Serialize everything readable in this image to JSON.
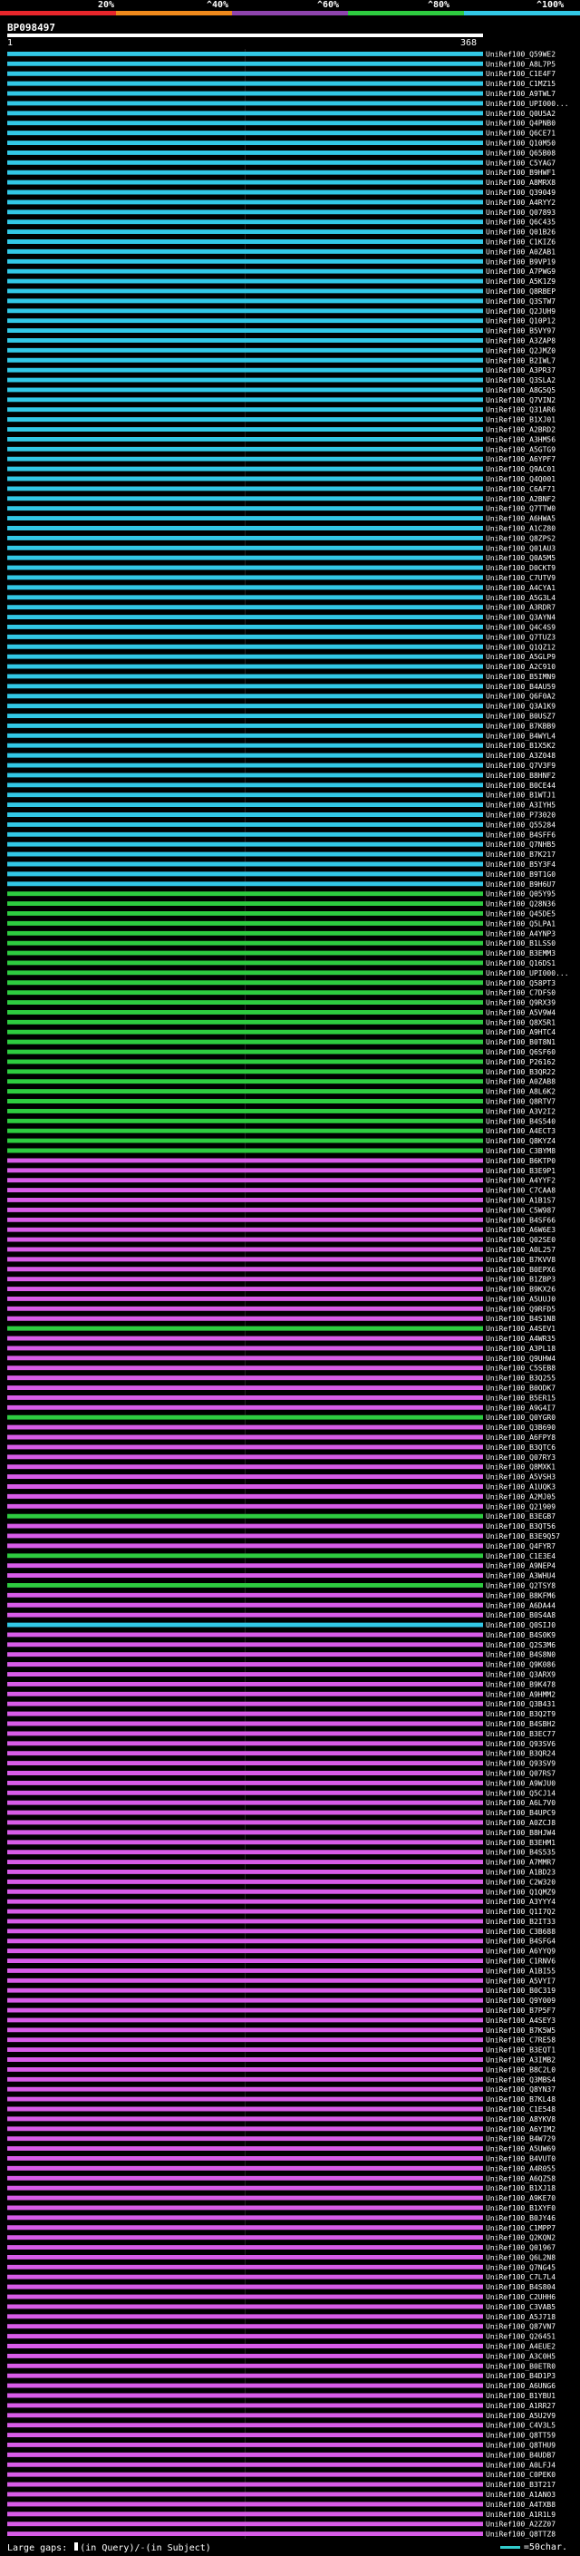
{
  "legend": {
    "labels": [
      "20%",
      "^40%",
      "^60%",
      "^80%",
      "^100%"
    ],
    "colors": [
      "#e8262b",
      "#f08a1c",
      "#8e44ad",
      "#2ecc40",
      "#32c8e6"
    ]
  },
  "query_id": "BP098497",
  "axis": {
    "start": "1",
    "end": "368"
  },
  "footer": {
    "prefix": "Large gaps:",
    "in_query": "(in Query)",
    "sep": "/",
    "in_subject": "(in Subject)"
  },
  "scale_key": "=50char.",
  "chart_data": {
    "type": "alignment",
    "query_length": 368,
    "hits": [
      {
        "id": "UniRef100_Q59WE2",
        "c": "cyan"
      },
      {
        "id": "UniRef100_A8L7P5",
        "c": "cyan"
      },
      {
        "id": "UniRef100_C1E4F7",
        "c": "cyan"
      },
      {
        "id": "UniRef100_C1MZ15",
        "c": "cyan"
      },
      {
        "id": "UniRef100_A9TWL7",
        "c": "cyan"
      },
      {
        "id": "UniRef100_UPI000...",
        "c": "cyan"
      },
      {
        "id": "UniRef100_Q0U5A2",
        "c": "cyan"
      },
      {
        "id": "UniRef100_Q4PNB0",
        "c": "cyan"
      },
      {
        "id": "UniRef100_Q6CE71",
        "c": "cyan"
      },
      {
        "id": "UniRef100_Q10M50",
        "c": "cyan"
      },
      {
        "id": "UniRef100_Q65B08",
        "c": "cyan"
      },
      {
        "id": "UniRef100_C5YAG7",
        "c": "cyan"
      },
      {
        "id": "UniRef100_B9HWF1",
        "c": "cyan"
      },
      {
        "id": "UniRef100_A8MRX8",
        "c": "cyan"
      },
      {
        "id": "UniRef100_Q39049",
        "c": "cyan"
      },
      {
        "id": "UniRef100_A4RYY2",
        "c": "cyan"
      },
      {
        "id": "UniRef100_Q07893",
        "c": "cyan"
      },
      {
        "id": "UniRef100_Q6C435",
        "c": "cyan"
      },
      {
        "id": "UniRef100_Q01B26",
        "c": "cyan"
      },
      {
        "id": "UniRef100_C1KIZ6",
        "c": "cyan"
      },
      {
        "id": "UniRef100_A0ZAB1",
        "c": "cyan"
      },
      {
        "id": "UniRef100_B9VP19",
        "c": "cyan"
      },
      {
        "id": "UniRef100_A7PWG9",
        "c": "cyan"
      },
      {
        "id": "UniRef100_A5K1Z9",
        "c": "cyan"
      },
      {
        "id": "UniRef100_Q8RBEP",
        "c": "cyan"
      },
      {
        "id": "UniRef100_Q3STW7",
        "c": "cyan"
      },
      {
        "id": "UniRef100_Q2JUH9",
        "c": "cyan"
      },
      {
        "id": "UniRef100_Q10P12",
        "c": "cyan"
      },
      {
        "id": "UniRef100_B5VY97",
        "c": "cyan"
      },
      {
        "id": "UniRef100_A3ZAP8",
        "c": "cyan"
      },
      {
        "id": "UniRef100_Q2JMZ0",
        "c": "cyan"
      },
      {
        "id": "UniRef100_B2IWL7",
        "c": "cyan"
      },
      {
        "id": "UniRef100_A3PR37",
        "c": "cyan"
      },
      {
        "id": "UniRef100_Q3SLA2",
        "c": "cyan"
      },
      {
        "id": "UniRef100_A8G5Q5",
        "c": "cyan"
      },
      {
        "id": "UniRef100_Q7VIN2",
        "c": "cyan"
      },
      {
        "id": "UniRef100_Q31AR6",
        "c": "cyan"
      },
      {
        "id": "UniRef100_B1XJ01",
        "c": "cyan"
      },
      {
        "id": "UniRef100_A2BRD2",
        "c": "cyan"
      },
      {
        "id": "UniRef100_A3HM56",
        "c": "cyan"
      },
      {
        "id": "UniRef100_A5GTG9",
        "c": "cyan"
      },
      {
        "id": "UniRef100_A6YPF7",
        "c": "cyan"
      },
      {
        "id": "UniRef100_Q9AC01",
        "c": "cyan"
      },
      {
        "id": "UniRef100_Q4Q001",
        "c": "cyan"
      },
      {
        "id": "UniRef100_C6AF71",
        "c": "cyan"
      },
      {
        "id": "UniRef100_A2BNF2",
        "c": "cyan"
      },
      {
        "id": "UniRef100_Q7TTW0",
        "c": "cyan"
      },
      {
        "id": "UniRef100_A6HWA5",
        "c": "cyan"
      },
      {
        "id": "UniRef100_A1CZ80",
        "c": "cyan"
      },
      {
        "id": "UniRef100_Q8ZPS2",
        "c": "cyan"
      },
      {
        "id": "UniRef100_Q01AU3",
        "c": "cyan"
      },
      {
        "id": "UniRef100_Q0A5M5",
        "c": "cyan"
      },
      {
        "id": "UniRef100_D0CKT9",
        "c": "cyan"
      },
      {
        "id": "UniRef100_C7UTV9",
        "c": "cyan"
      },
      {
        "id": "UniRef100_A4CYA1",
        "c": "cyan"
      },
      {
        "id": "UniRef100_A5G3L4",
        "c": "cyan"
      },
      {
        "id": "UniRef100_A3RDR7",
        "c": "cyan"
      },
      {
        "id": "UniRef100_Q3AYN4",
        "c": "cyan"
      },
      {
        "id": "UniRef100_Q4C4S9",
        "c": "cyan"
      },
      {
        "id": "UniRef100_Q7TUZ3",
        "c": "cyan"
      },
      {
        "id": "UniRef100_Q1QZ12",
        "c": "cyan"
      },
      {
        "id": "UniRef100_A5GLP9",
        "c": "cyan"
      },
      {
        "id": "UniRef100_A2C910",
        "c": "cyan"
      },
      {
        "id": "UniRef100_B5IMN9",
        "c": "cyan"
      },
      {
        "id": "UniRef100_B4AU59",
        "c": "cyan"
      },
      {
        "id": "UniRef100_Q6F0A2",
        "c": "cyan"
      },
      {
        "id": "UniRef100_Q3A1K9",
        "c": "cyan"
      },
      {
        "id": "UniRef100_B0USZ7",
        "c": "cyan"
      },
      {
        "id": "UniRef100_B7KBB9",
        "c": "cyan"
      },
      {
        "id": "UniRef100_B4WYL4",
        "c": "cyan"
      },
      {
        "id": "UniRef100_B1X5K2",
        "c": "cyan"
      },
      {
        "id": "UniRef100_A3Z048",
        "c": "cyan"
      },
      {
        "id": "UniRef100_Q7V3F9",
        "c": "cyan"
      },
      {
        "id": "UniRef100_B8HNF2",
        "c": "cyan"
      },
      {
        "id": "UniRef100_B0CE44",
        "c": "cyan"
      },
      {
        "id": "UniRef100_B1WTJ1",
        "c": "cyan"
      },
      {
        "id": "UniRef100_A3IYH5",
        "c": "cyan"
      },
      {
        "id": "UniRef100_P73020",
        "c": "cyan"
      },
      {
        "id": "UniRef100_Q55284",
        "c": "cyan"
      },
      {
        "id": "UniRef100_B4SFF6",
        "c": "cyan"
      },
      {
        "id": "UniRef100_Q7NHB5",
        "c": "cyan"
      },
      {
        "id": "UniRef100_B7K217",
        "c": "cyan"
      },
      {
        "id": "UniRef100_B5Y3F4",
        "c": "cyan"
      },
      {
        "id": "UniRef100_B9T1G0",
        "c": "cyan"
      },
      {
        "id": "UniRef100_B9H6U7",
        "c": "cyan"
      },
      {
        "id": "UniRef100_Q05Y95",
        "c": "green"
      },
      {
        "id": "UniRef100_Q28N36",
        "c": "green"
      },
      {
        "id": "UniRef100_Q45DE5",
        "c": "green"
      },
      {
        "id": "UniRef100_Q5LPA1",
        "c": "green"
      },
      {
        "id": "UniRef100_A4YNP3",
        "c": "green"
      },
      {
        "id": "UniRef100_B1LSS0",
        "c": "green"
      },
      {
        "id": "UniRef100_B3EMM3",
        "c": "green"
      },
      {
        "id": "UniRef100_Q16DS1",
        "c": "green"
      },
      {
        "id": "UniRef100_UPI000...",
        "c": "green"
      },
      {
        "id": "UniRef100_Q58PT3",
        "c": "green"
      },
      {
        "id": "UniRef100_C7DFS0",
        "c": "green"
      },
      {
        "id": "UniRef100_Q9RX39",
        "c": "green"
      },
      {
        "id": "UniRef100_A5V9W4",
        "c": "green"
      },
      {
        "id": "UniRef100_Q8X5R1",
        "c": "green"
      },
      {
        "id": "UniRef100_A9HTC4",
        "c": "green"
      },
      {
        "id": "UniRef100_B0T8N1",
        "c": "green"
      },
      {
        "id": "UniRef100_Q6SF60",
        "c": "green"
      },
      {
        "id": "UniRef100_P26162",
        "c": "green"
      },
      {
        "id": "UniRef100_B3QR22",
        "c": "green"
      },
      {
        "id": "UniRef100_A0ZAB8",
        "c": "green"
      },
      {
        "id": "UniRef100_A8L6K2",
        "c": "green"
      },
      {
        "id": "UniRef100_Q8RTV7",
        "c": "green"
      },
      {
        "id": "UniRef100_A3V2I2",
        "c": "green"
      },
      {
        "id": "UniRef100_B4S540",
        "c": "green"
      },
      {
        "id": "UniRef100_A4ECT3",
        "c": "green"
      },
      {
        "id": "UniRef100_Q8KYZ4",
        "c": "green"
      },
      {
        "id": "UniRef100_C3BYM8",
        "c": "green"
      },
      {
        "id": "UniRef100_B6KTP0",
        "c": "magenta"
      },
      {
        "id": "UniRef100_B3E9P1",
        "c": "magenta"
      },
      {
        "id": "UniRef100_A4YYF2",
        "c": "magenta"
      },
      {
        "id": "UniRef100_C7CAA8",
        "c": "magenta"
      },
      {
        "id": "UniRef100_A1B1S7",
        "c": "magenta"
      },
      {
        "id": "UniRef100_C5W987",
        "c": "magenta"
      },
      {
        "id": "UniRef100_B4SF66",
        "c": "magenta"
      },
      {
        "id": "UniRef100_A6W6E3",
        "c": "magenta"
      },
      {
        "id": "UniRef100_Q02SE0",
        "c": "magenta"
      },
      {
        "id": "UniRef100_A0L257",
        "c": "magenta"
      },
      {
        "id": "UniRef100_B7KVV8",
        "c": "magenta"
      },
      {
        "id": "UniRef100_B0EPX6",
        "c": "magenta"
      },
      {
        "id": "UniRef100_B1ZBP3",
        "c": "magenta"
      },
      {
        "id": "UniRef100_B9KX26",
        "c": "magenta"
      },
      {
        "id": "UniRef100_A5UUJ0",
        "c": "magenta"
      },
      {
        "id": "UniRef100_Q9RFD5",
        "c": "magenta"
      },
      {
        "id": "UniRef100_B4S1N8",
        "c": "magenta"
      },
      {
        "id": "UniRef100_A4SEV1",
        "c": "green"
      },
      {
        "id": "UniRef100_A4WR35",
        "c": "magenta"
      },
      {
        "id": "UniRef100_A3PL18",
        "c": "magenta"
      },
      {
        "id": "UniRef100_Q9UHW4",
        "c": "magenta"
      },
      {
        "id": "UniRef100_C5SEB8",
        "c": "magenta"
      },
      {
        "id": "UniRef100_B3Q255",
        "c": "magenta"
      },
      {
        "id": "UniRef100_B0ODK7",
        "c": "magenta"
      },
      {
        "id": "UniRef100_B5ER15",
        "c": "magenta"
      },
      {
        "id": "UniRef100_A9G4I7",
        "c": "magenta"
      },
      {
        "id": "UniRef100_Q0YGR0",
        "c": "green"
      },
      {
        "id": "UniRef100_Q3B690",
        "c": "magenta"
      },
      {
        "id": "UniRef100_A6FPY8",
        "c": "magenta"
      },
      {
        "id": "UniRef100_B3QTC6",
        "c": "magenta"
      },
      {
        "id": "UniRef100_Q07RY3",
        "c": "magenta"
      },
      {
        "id": "UniRef100_Q8MXK1",
        "c": "magenta"
      },
      {
        "id": "UniRef100_A5VSH3",
        "c": "magenta"
      },
      {
        "id": "UniRef100_A1UQK3",
        "c": "magenta"
      },
      {
        "id": "UniRef100_A2MJ05",
        "c": "magenta"
      },
      {
        "id": "UniRef100_Q21909",
        "c": "magenta"
      },
      {
        "id": "UniRef100_B3EGB7",
        "c": "green"
      },
      {
        "id": "UniRef100_B3QT56",
        "c": "magenta"
      },
      {
        "id": "UniRef100_B3E9Q57",
        "c": "magenta"
      },
      {
        "id": "UniRef100_Q4FYR7",
        "c": "magenta"
      },
      {
        "id": "UniRef100_C1E3E4",
        "c": "green"
      },
      {
        "id": "UniRef100_A9NEP4",
        "c": "magenta"
      },
      {
        "id": "UniRef100_A3WHU4",
        "c": "magenta"
      },
      {
        "id": "UniRef100_Q2TSY8",
        "c": "green"
      },
      {
        "id": "UniRef100_B8KFM6",
        "c": "magenta"
      },
      {
        "id": "UniRef100_A6DA44",
        "c": "magenta"
      },
      {
        "id": "UniRef100_B0S4A8",
        "c": "magenta"
      },
      {
        "id": "UniRef100_Q0SIJ0",
        "c": "cyan"
      },
      {
        "id": "UniRef100_B4S0K9",
        "c": "magenta"
      },
      {
        "id": "UniRef100_Q2S3M6",
        "c": "magenta"
      },
      {
        "id": "UniRef100_B4S8N0",
        "c": "magenta"
      },
      {
        "id": "UniRef100_Q9K086",
        "c": "magenta"
      },
      {
        "id": "UniRef100_Q3ARX9",
        "c": "magenta"
      },
      {
        "id": "UniRef100_B9K478",
        "c": "magenta"
      },
      {
        "id": "UniRef100_A9HMM2",
        "c": "magenta"
      },
      {
        "id": "UniRef100_Q3B431",
        "c": "magenta"
      },
      {
        "id": "UniRef100_B3Q2T9",
        "c": "magenta"
      },
      {
        "id": "UniRef100_B4SBH2",
        "c": "magenta"
      },
      {
        "id": "UniRef100_B3EC77",
        "c": "magenta"
      },
      {
        "id": "UniRef100_Q93SV6",
        "c": "magenta"
      },
      {
        "id": "UniRef100_B3QR24",
        "c": "magenta"
      },
      {
        "id": "UniRef100_Q93SV9",
        "c": "magenta"
      },
      {
        "id": "UniRef100_Q07RS7",
        "c": "magenta"
      },
      {
        "id": "UniRef100_A9WJU0",
        "c": "magenta"
      },
      {
        "id": "UniRef100_Q5CJ14",
        "c": "magenta"
      },
      {
        "id": "UniRef100_A6L7V0",
        "c": "magenta"
      },
      {
        "id": "UniRef100_B4UPC9",
        "c": "magenta"
      },
      {
        "id": "UniRef100_A0ZCJ8",
        "c": "magenta"
      },
      {
        "id": "UniRef100_B8HJW4",
        "c": "magenta"
      },
      {
        "id": "UniRef100_B3EHM1",
        "c": "magenta"
      },
      {
        "id": "UniRef100_B4S535",
        "c": "magenta"
      },
      {
        "id": "UniRef100_A7MMR7",
        "c": "magenta"
      },
      {
        "id": "UniRef100_A1BD23",
        "c": "magenta"
      },
      {
        "id": "UniRef100_C2W320",
        "c": "magenta"
      },
      {
        "id": "UniRef100_Q1QMZ9",
        "c": "magenta"
      },
      {
        "id": "UniRef100_A3YYY4",
        "c": "magenta"
      },
      {
        "id": "UniRef100_Q1I7Q2",
        "c": "magenta"
      },
      {
        "id": "UniRef100_B2IT33",
        "c": "magenta"
      },
      {
        "id": "UniRef100_C3B688",
        "c": "magenta"
      },
      {
        "id": "UniRef100_B4SFG4",
        "c": "magenta"
      },
      {
        "id": "UniRef100_A6YYQ9",
        "c": "magenta"
      },
      {
        "id": "UniRef100_C1RNV6",
        "c": "magenta"
      },
      {
        "id": "UniRef100_A1BI55",
        "c": "magenta"
      },
      {
        "id": "UniRef100_A5VYI7",
        "c": "magenta"
      },
      {
        "id": "UniRef100_B0C319",
        "c": "magenta"
      },
      {
        "id": "UniRef100_Q9Y009",
        "c": "magenta"
      },
      {
        "id": "UniRef100_B7P5F7",
        "c": "magenta"
      },
      {
        "id": "UniRef100_A4SEY3",
        "c": "magenta"
      },
      {
        "id": "UniRef100_B7K5W5",
        "c": "magenta"
      },
      {
        "id": "UniRef100_C7RE58",
        "c": "magenta"
      },
      {
        "id": "UniRef100_B3EQT1",
        "c": "magenta"
      },
      {
        "id": "UniRef100_A3IMB2",
        "c": "magenta"
      },
      {
        "id": "UniRef100_B8C2L0",
        "c": "magenta"
      },
      {
        "id": "UniRef100_Q3MBS4",
        "c": "magenta"
      },
      {
        "id": "UniRef100_Q8YN37",
        "c": "magenta"
      },
      {
        "id": "UniRef100_B7KL48",
        "c": "magenta"
      },
      {
        "id": "UniRef100_C1E548",
        "c": "magenta"
      },
      {
        "id": "UniRef100_A8YKV8",
        "c": "magenta"
      },
      {
        "id": "UniRef100_A6YIM2",
        "c": "magenta"
      },
      {
        "id": "UniRef100_B4W729",
        "c": "magenta"
      },
      {
        "id": "UniRef100_A5UW69",
        "c": "magenta"
      },
      {
        "id": "UniRef100_B4VUT0",
        "c": "magenta"
      },
      {
        "id": "UniRef100_A4R055",
        "c": "magenta"
      },
      {
        "id": "UniRef100_A6QZ58",
        "c": "magenta"
      },
      {
        "id": "UniRef100_B1XJ18",
        "c": "magenta"
      },
      {
        "id": "UniRef100_A9KE70",
        "c": "magenta"
      },
      {
        "id": "UniRef100_B1XYF0",
        "c": "magenta"
      },
      {
        "id": "UniRef100_B0JY46",
        "c": "magenta"
      },
      {
        "id": "UniRef100_C1MPP7",
        "c": "magenta"
      },
      {
        "id": "UniRef100_Q2KQN2",
        "c": "magenta"
      },
      {
        "id": "UniRef100_Q01967",
        "c": "magenta"
      },
      {
        "id": "UniRef100_Q6L2N8",
        "c": "magenta"
      },
      {
        "id": "UniRef100_Q7NG45",
        "c": "magenta"
      },
      {
        "id": "UniRef100_C7L7L4",
        "c": "magenta"
      },
      {
        "id": "UniRef100_B4S804",
        "c": "magenta"
      },
      {
        "id": "UniRef100_C2UHH6",
        "c": "magenta"
      },
      {
        "id": "UniRef100_C3VAB5",
        "c": "magenta"
      },
      {
        "id": "UniRef100_A5J718",
        "c": "magenta"
      },
      {
        "id": "UniRef100_Q87VN7",
        "c": "magenta"
      },
      {
        "id": "UniRef100_Q26451",
        "c": "magenta"
      },
      {
        "id": "UniRef100_A4EUE2",
        "c": "magenta"
      },
      {
        "id": "UniRef100_A3C0H5",
        "c": "magenta"
      },
      {
        "id": "UniRef100_B0ETR0",
        "c": "magenta"
      },
      {
        "id": "UniRef100_B4D1P3",
        "c": "magenta"
      },
      {
        "id": "UniRef100_A6UNG6",
        "c": "magenta"
      },
      {
        "id": "UniRef100_B1YBU1",
        "c": "magenta"
      },
      {
        "id": "UniRef100_A1RR27",
        "c": "magenta"
      },
      {
        "id": "UniRef100_A5U2V9",
        "c": "magenta"
      },
      {
        "id": "UniRef100_C4V3L5",
        "c": "magenta"
      },
      {
        "id": "UniRef100_Q8TT59",
        "c": "magenta"
      },
      {
        "id": "UniRef100_Q8THU9",
        "c": "magenta"
      },
      {
        "id": "UniRef100_B4UDB7",
        "c": "magenta"
      },
      {
        "id": "UniRef100_A0LFJ4",
        "c": "magenta"
      },
      {
        "id": "UniRef100_C0PEK0",
        "c": "magenta"
      },
      {
        "id": "UniRef100_B3T217",
        "c": "magenta"
      },
      {
        "id": "UniRef100_A1ANO3",
        "c": "magenta"
      },
      {
        "id": "UniRef100_A4TXB8",
        "c": "magenta"
      },
      {
        "id": "UniRef100_A1R1L9",
        "c": "magenta"
      },
      {
        "id": "UniRef100_A2ZZ07",
        "c": "magenta"
      },
      {
        "id": "UniRef100_Q8TTZ8",
        "c": "magenta"
      }
    ]
  }
}
